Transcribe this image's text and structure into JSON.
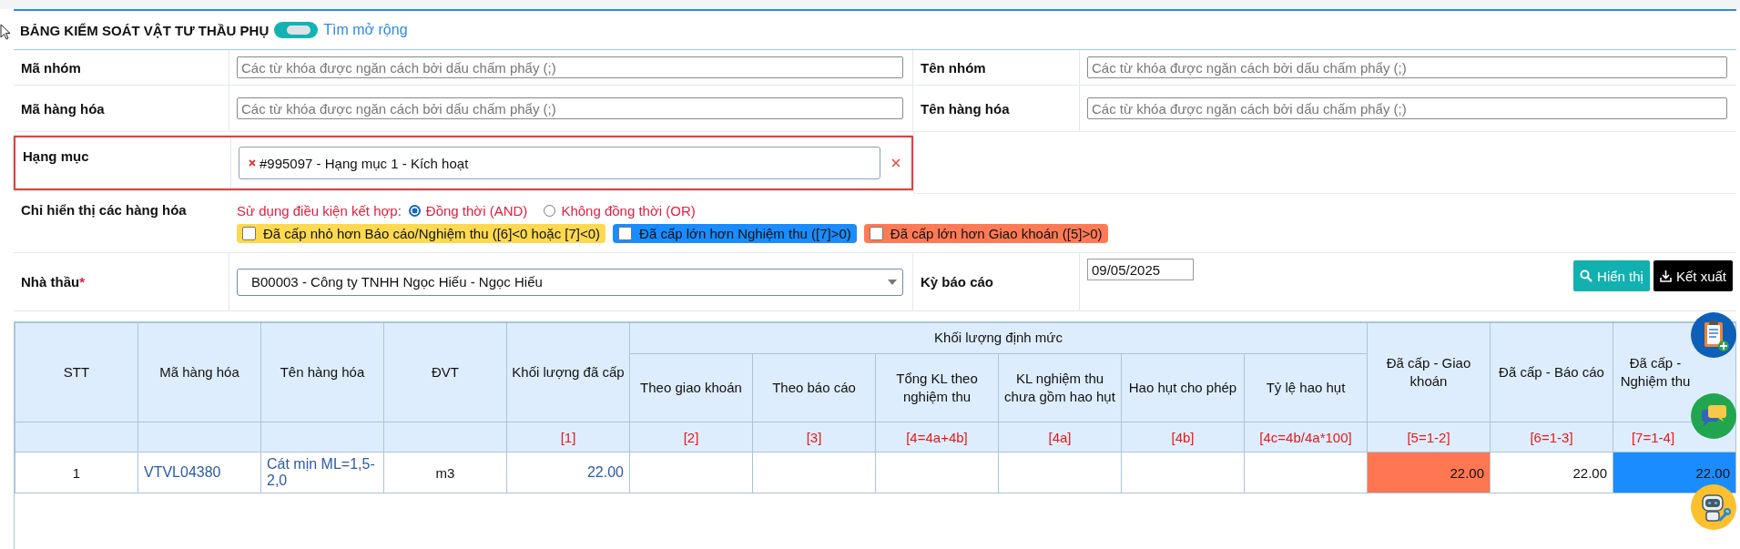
{
  "title": "BẢNG KIỂM SOÁT VẬT TƯ THẦU PHỤ",
  "extended_search": {
    "on": true,
    "label": "Tìm mở rộng"
  },
  "fields": [
    {
      "label": "Mã nhóm",
      "placeholder": "Các từ khóa được ngăn cách bởi dấu chấm phẩy (;)"
    },
    {
      "label": "Tên nhóm",
      "placeholder": "Các từ khóa được ngăn cách bởi dấu chấm phẩy (;)"
    },
    {
      "label": "Mã hàng hóa",
      "placeholder": "Các từ khóa được ngăn cách bởi dấu chấm phẩy (;)"
    },
    {
      "label": "Tên hàng hóa",
      "placeholder": "Các từ khóa được ngăn cách bởi dấu chấm phẩy (;)"
    }
  ],
  "category": {
    "label": "Hạng mục",
    "highlighted": true,
    "tags": [
      "#995097 - Hạng mục 1 - Kích hoạt"
    ]
  },
  "display_filter": {
    "label": "Chỉ hiển thị các hàng hóa",
    "combine_label": "Sử dụng điều kiện kết hợp:",
    "radios": [
      {
        "label": "Đồng thời (AND)",
        "selected": true
      },
      {
        "label": "Không đồng thời (OR)",
        "selected": false
      }
    ],
    "checkboxes": [
      {
        "label": "Đã cấp nhỏ hơn Báo cáo/Nghiệm thu ([6]<0 hoặc [7]<0)",
        "checked": false,
        "color": "#fdd94f"
      },
      {
        "label": "Đã cấp lớn hơn Nghiệm thu ([7]>0)",
        "checked": false,
        "color": "#1a8cff"
      },
      {
        "label": "Đã cấp lớn hơn Giao khoán ([5]>0)",
        "checked": false,
        "color": "#ff7a55"
      }
    ]
  },
  "contractor": {
    "label": "Nhà thầu",
    "required_mark": "*",
    "value": "B00003 - Công ty TNHH Ngọc Hiếu - Ngọc Hiếu"
  },
  "report_period": {
    "label": "Kỳ báo cáo",
    "value": "09/05/2025"
  },
  "buttons": [
    {
      "label": "Hiển thị",
      "kind": "search"
    },
    {
      "label": "Kết xuất",
      "kind": "export"
    }
  ],
  "table": {
    "columns": [
      {
        "label": "STT"
      },
      {
        "label": "Mã hàng hóa"
      },
      {
        "label": "Tên hàng hóa"
      },
      {
        "label": "ĐVT"
      },
      {
        "label": "Khối lượng đã cấp",
        "ref": "[1]"
      },
      {
        "label": "Khối lượng định mức",
        "children": [
          {
            "label": "Theo giao khoán",
            "ref": "[2]"
          },
          {
            "label": "Theo báo cáo",
            "ref": "[3]"
          },
          {
            "label": "Tổng KL theo nghiệm thu",
            "ref": "[4=4a+4b]"
          },
          {
            "label": "KL nghiệm thu chưa gồm hao hụt",
            "ref": "[4a]"
          },
          {
            "label": "Hao hụt cho phép",
            "ref": "[4b]"
          },
          {
            "label": "Tỷ lệ hao hụt",
            "ref": "[4c=4b/4a*100]"
          }
        ]
      },
      {
        "label": "Đã cấp - Giao khoán",
        "ref": "[5=1-2]"
      },
      {
        "label": "Đã cấp - Báo cáo",
        "ref": "[6=1-3]"
      },
      {
        "label": "Đã cấp - Nghiệm thu",
        "ref": "[7=1-4]"
      }
    ],
    "rows": [
      {
        "cells": [
          {
            "text": "1",
            "kind": "center"
          },
          {
            "text": "VTVL04380",
            "kind": "link"
          },
          {
            "text": "Cát mịn ML=1,5-2,0",
            "kind": "link"
          },
          {
            "text": "m3",
            "kind": "center"
          },
          {
            "text": "22.00",
            "kind": "link-number"
          },
          null,
          null,
          null,
          null,
          null,
          null,
          {
            "text": "22.00",
            "kind": "number",
            "color": "#ff7752"
          },
          {
            "text": "22.00",
            "kind": "number"
          },
          {
            "text": "22.00",
            "kind": "number",
            "color": "#1a8cff"
          }
        ]
      }
    ]
  }
}
